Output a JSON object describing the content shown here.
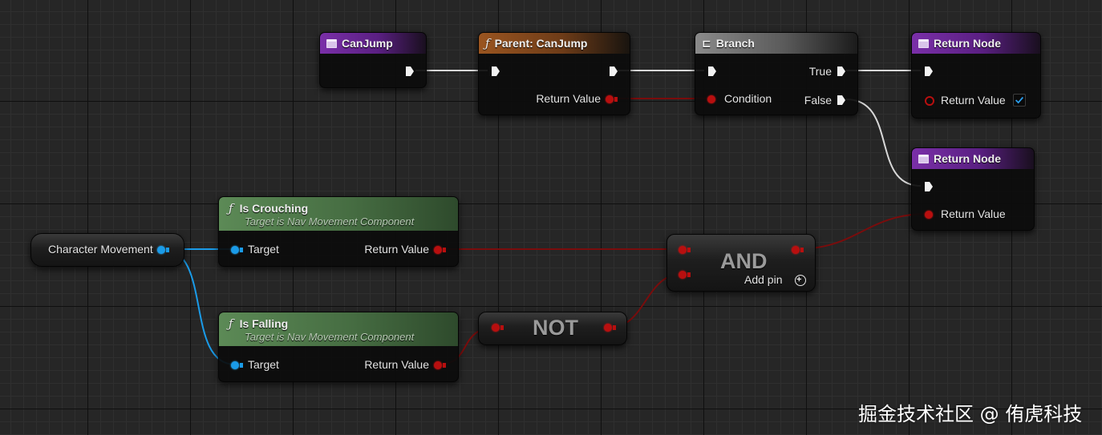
{
  "nodes": {
    "canjump_event": {
      "title": "CanJump"
    },
    "parent_canjump": {
      "title": "Parent: CanJump",
      "return_label": "Return Value"
    },
    "branch": {
      "title": "Branch",
      "true_label": "True",
      "false_label": "False",
      "condition_label": "Condition"
    },
    "return_node_top": {
      "title": "Return Node",
      "return_label": "Return Value",
      "checked": true
    },
    "return_node_bottom": {
      "title": "Return Node",
      "return_label": "Return Value"
    },
    "is_crouching": {
      "title": "Is Crouching",
      "subtitle": "Target is Nav Movement Component",
      "target_label": "Target",
      "return_label": "Return Value"
    },
    "is_falling": {
      "title": "Is Falling",
      "subtitle": "Target is Nav Movement Component",
      "target_label": "Target",
      "return_label": "Return Value"
    },
    "character_movement": {
      "label": "Character Movement"
    },
    "and_node": {
      "label": "AND",
      "add_pin_label": "Add pin"
    },
    "not_node": {
      "label": "NOT"
    }
  },
  "colors": {
    "exec_wire": "#d8d8d8",
    "bool_wire": "#7a0c0c",
    "object_wire": "#1a9be8"
  },
  "watermark": "掘金技术社区 @ 侑虎科技"
}
